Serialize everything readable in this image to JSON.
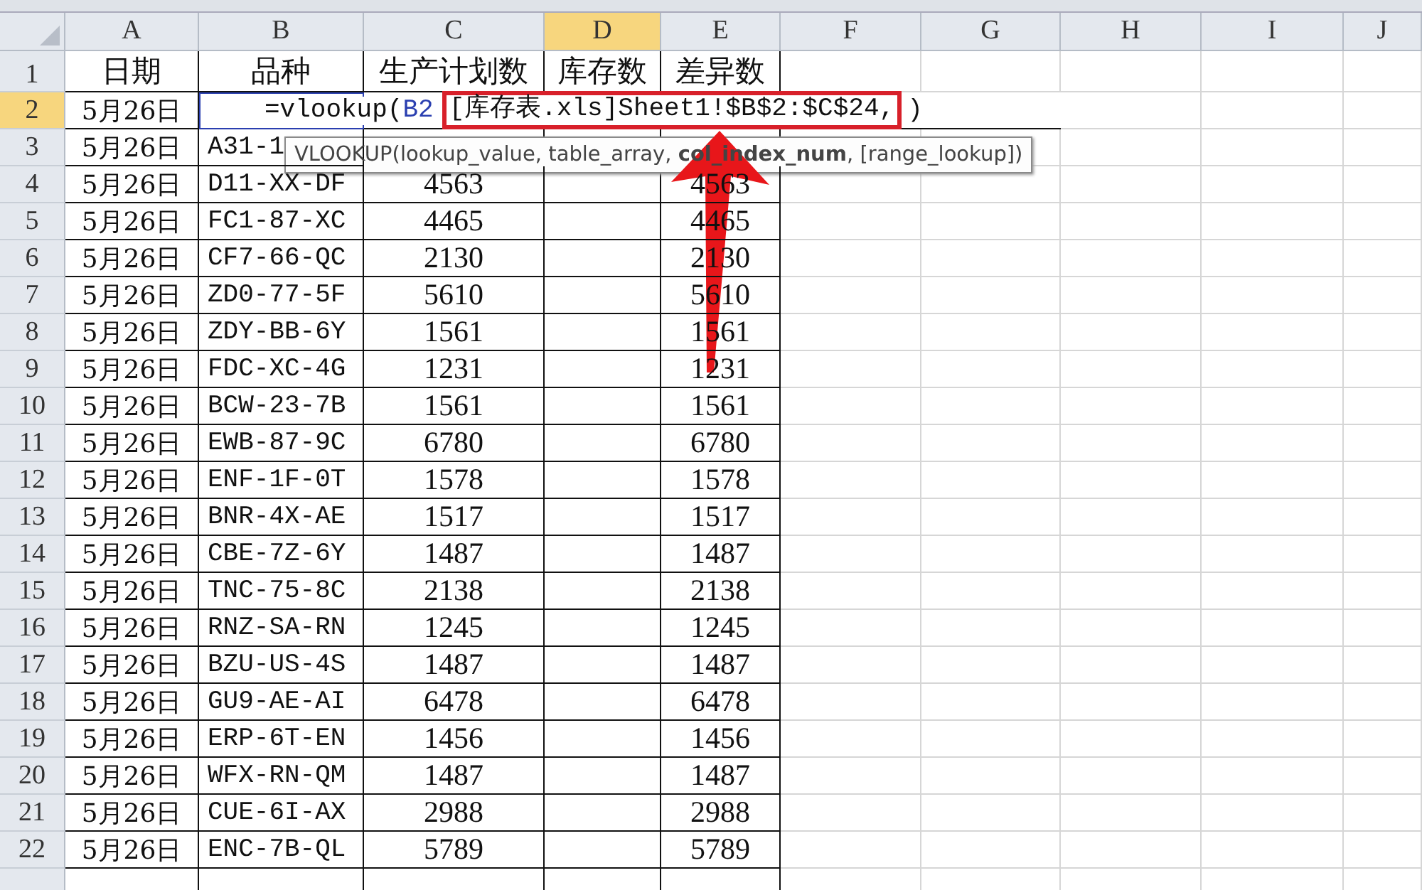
{
  "columns": [
    {
      "label": "A",
      "selected": false
    },
    {
      "label": "B",
      "selected": false
    },
    {
      "label": "C",
      "selected": false
    },
    {
      "label": "D",
      "selected": true
    },
    {
      "label": "E",
      "selected": false
    },
    {
      "label": "F",
      "selected": false
    },
    {
      "label": "G",
      "selected": false
    },
    {
      "label": "H",
      "selected": false
    },
    {
      "label": "I",
      "selected": false
    },
    {
      "label": "J",
      "selected": false
    }
  ],
  "rows": [
    {
      "kind": "header",
      "num": "1",
      "selected": false,
      "cells": [
        "日期",
        "品种",
        "生产计划数",
        "库存数",
        "差异数"
      ]
    },
    {
      "kind": "editing",
      "num": "2",
      "selected": true,
      "date": "5月26日",
      "formula": {
        "prefix": "=vlookup(",
        "cell_ref": "B2",
        "range": "[库存表.xls]Sheet1!$B$2:$C$24,",
        "suffix": ")"
      }
    },
    {
      "kind": "data",
      "num": "3",
      "selected": false,
      "date": "5月26日",
      "variety": "A31-1"
    },
    {
      "kind": "data",
      "num": "4",
      "selected": false,
      "date": "5月26日",
      "variety": "D11-XX-DF",
      "plan": "4563",
      "diff": "4563"
    },
    {
      "kind": "data",
      "num": "5",
      "selected": false,
      "date": "5月26日",
      "variety": "FC1-87-XC",
      "plan": "4465",
      "diff": "4465"
    },
    {
      "kind": "data",
      "num": "6",
      "selected": false,
      "date": "5月26日",
      "variety": "CF7-66-QC",
      "plan": "2130",
      "diff": "2130"
    },
    {
      "kind": "data",
      "num": "7",
      "selected": false,
      "date": "5月26日",
      "variety": "ZD0-77-5F",
      "plan": "5610",
      "diff": "5610"
    },
    {
      "kind": "data",
      "num": "8",
      "selected": false,
      "date": "5月26日",
      "variety": "ZDY-BB-6Y",
      "plan": "1561",
      "diff": "1561"
    },
    {
      "kind": "data",
      "num": "9",
      "selected": false,
      "date": "5月26日",
      "variety": "FDC-XC-4G",
      "plan": "1231",
      "diff": "1231"
    },
    {
      "kind": "data",
      "num": "10",
      "selected": false,
      "date": "5月26日",
      "variety": "BCW-23-7B",
      "plan": "1561",
      "diff": "1561"
    },
    {
      "kind": "data",
      "num": "11",
      "selected": false,
      "date": "5月26日",
      "variety": "EWB-87-9C",
      "plan": "6780",
      "diff": "6780"
    },
    {
      "kind": "data",
      "num": "12",
      "selected": false,
      "date": "5月26日",
      "variety": "ENF-1F-0T",
      "plan": "1578",
      "diff": "1578"
    },
    {
      "kind": "data",
      "num": "13",
      "selected": false,
      "date": "5月26日",
      "variety": "BNR-4X-AE",
      "plan": "1517",
      "diff": "1517"
    },
    {
      "kind": "data",
      "num": "14",
      "selected": false,
      "date": "5月26日",
      "variety": "CBE-7Z-6Y",
      "plan": "1487",
      "diff": "1487"
    },
    {
      "kind": "data",
      "num": "15",
      "selected": false,
      "date": "5月26日",
      "variety": "TNC-75-8C",
      "plan": "2138",
      "diff": "2138"
    },
    {
      "kind": "data",
      "num": "16",
      "selected": false,
      "date": "5月26日",
      "variety": "RNZ-SA-RN",
      "plan": "1245",
      "diff": "1245"
    },
    {
      "kind": "data",
      "num": "17",
      "selected": false,
      "date": "5月26日",
      "variety": "BZU-US-4S",
      "plan": "1487",
      "diff": "1487"
    },
    {
      "kind": "data",
      "num": "18",
      "selected": false,
      "date": "5月26日",
      "variety": "GU9-AE-AI",
      "plan": "6478",
      "diff": "6478"
    },
    {
      "kind": "data",
      "num": "19",
      "selected": false,
      "date": "5月26日",
      "variety": "ERP-6T-EN",
      "plan": "1456",
      "diff": "1456"
    },
    {
      "kind": "data",
      "num": "20",
      "selected": false,
      "date": "5月26日",
      "variety": "WFX-RN-QM",
      "plan": "1487",
      "diff": "1487"
    },
    {
      "kind": "data",
      "num": "21",
      "selected": false,
      "date": "5月26日",
      "variety": "CUE-6I-AX",
      "plan": "2988",
      "diff": "2988"
    },
    {
      "kind": "data",
      "num": "22",
      "selected": false,
      "date": "5月26日",
      "variety": "ENC-7B-QL",
      "plan": "5789",
      "diff": "5789"
    }
  ],
  "tooltip": "VLOOKUP(lookup_value, table_array, **col_index_num**, [range_lookup])"
}
